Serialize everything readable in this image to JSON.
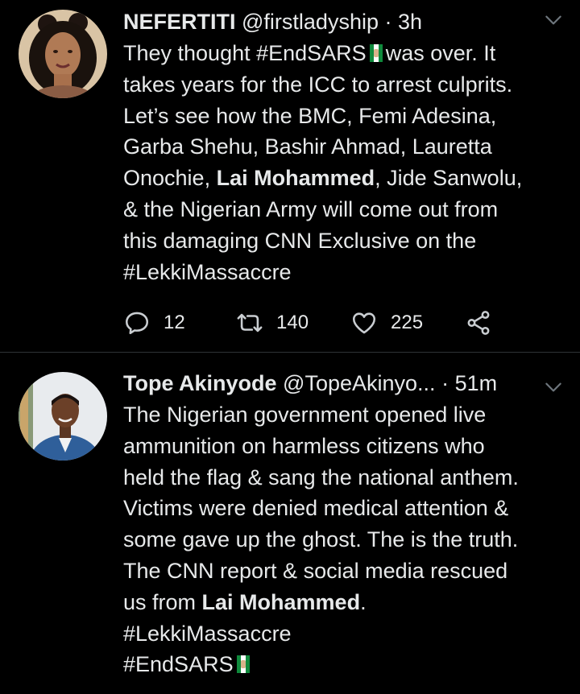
{
  "tweets": [
    {
      "name": "NEFERTITI",
      "handle": "@firstladyship",
      "dot": "·",
      "time": "3h",
      "lines": [
        [
          "They thought #EndSARS",
          "FLAG",
          " was over. It"
        ],
        [
          "takes years for the ICC to arrest culprits."
        ],
        [
          "Let’s see how the BMC, Femi Adesina,"
        ],
        [
          "Garba Shehu, Bashir Ahmad, Lauretta"
        ],
        [
          "Onochie, ",
          "Lai Mohammed",
          ", Jide Sanwolu,"
        ],
        [
          "& the Nigerian Army will come out from"
        ],
        [
          "this damaging CNN Exclusive on the"
        ],
        [
          "#LekkiMassaccre"
        ]
      ],
      "line_parts": {
        "l1a": "They thought #EndSARS",
        "l1b": "was over. It",
        "l2": "takes years for the ICC to arrest culprits.",
        "l3": "Let’s see how the BMC, Femi Adesina,",
        "l4": "Garba Shehu, Bashir Ahmad, Lauretta",
        "l5a": "Onochie, ",
        "l5b": "Lai Mohammed",
        "l5c": ", Jide Sanwolu,",
        "l6": "& the Nigerian Army will come out from",
        "l7": "this damaging CNN Exclusive on the",
        "l8": "#LekkiMassaccre"
      },
      "replies": "12",
      "retweets": "140",
      "likes": "225"
    },
    {
      "name": "Tope Akinyode",
      "handle": "@TopeAkinyo...",
      "dot": "·",
      "time": "51m",
      "line_parts": {
        "l1": "The Nigerian government opened live",
        "l2": "ammunition on harmless citizens who",
        "l3": "held the flag & sang the national anthem.",
        "l4": "Victims were denied medical attention &",
        "l5": "some gave up the ghost. The is the truth.",
        "l6": "The CNN report & social media rescued",
        "l7a": "us from ",
        "l7b": "Lai Mohammed",
        "l7c": ".",
        "l8": "#LekkiMassaccre",
        "l9": "#EndSARS"
      }
    }
  ],
  "icons": {
    "reply": "reply-icon",
    "retweet": "retweet-icon",
    "like": "heart-icon",
    "share": "share-icon",
    "menu": "chevron-down-icon",
    "flag": "raised-fist-flag-emoji"
  },
  "colors": {
    "background": "#000000",
    "text": "#e7e9ea",
    "divider": "#2f3336",
    "icon": "#c9cdd1",
    "flag_green": "#0f8a3c"
  }
}
